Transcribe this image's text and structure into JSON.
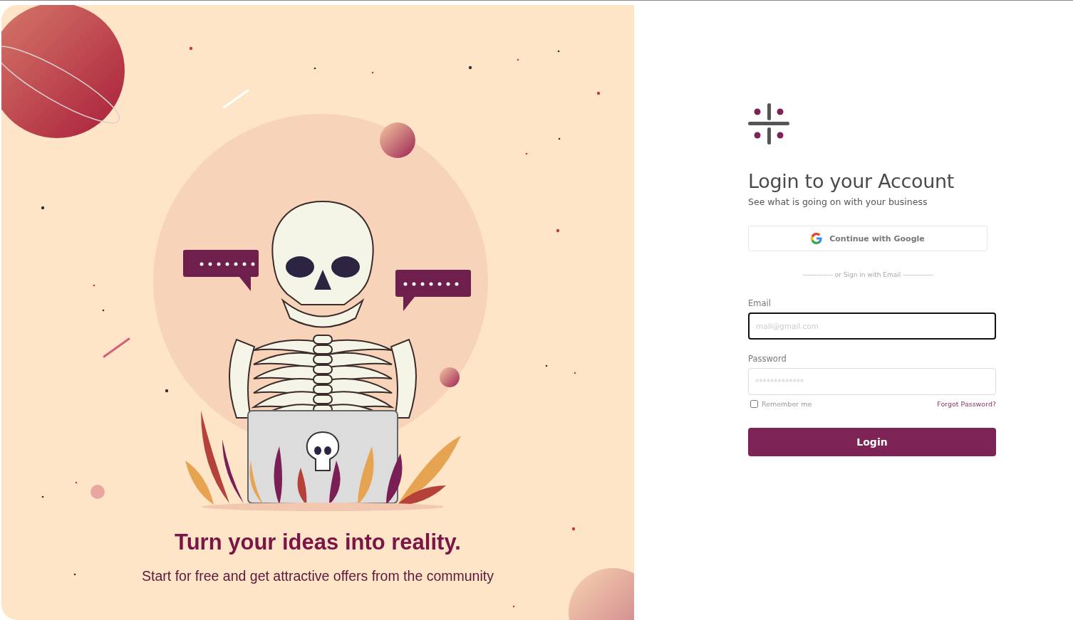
{
  "hero": {
    "title": "Turn your ideas into reality.",
    "subtitle": "Start for free and get attractive offers from the community"
  },
  "login": {
    "title": "Login to your Account",
    "subtitle": "See what is going on with your business",
    "google_button": "Continue with Google",
    "divider": "------------- or Sign in with Email -------------",
    "fields": [
      {
        "label": "Email",
        "placeholder": "mail@gmail.com",
        "focused": true
      },
      {
        "label": "Password",
        "placeholder": "*************",
        "focused": false
      }
    ],
    "remember": {
      "label": "Remember me",
      "checked": false
    },
    "forgot": "Forgot Password?",
    "submit": "Login"
  }
}
